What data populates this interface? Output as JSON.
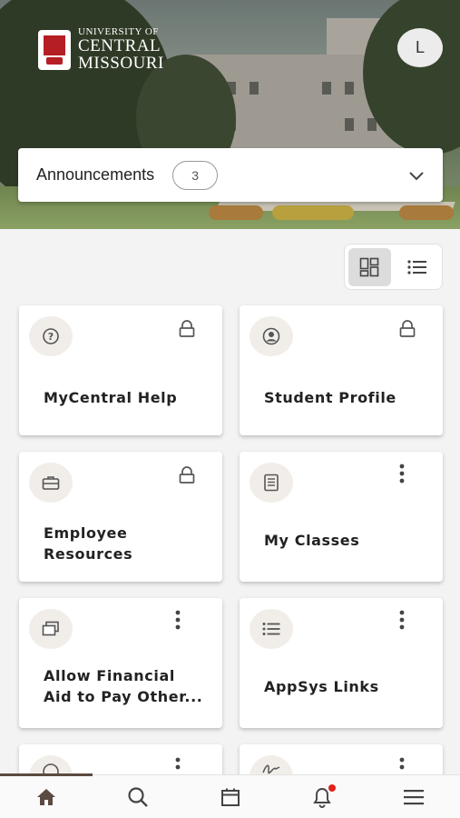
{
  "header": {
    "logo_line1": "UNIVERSITY OF",
    "logo_line2": "CENTRAL",
    "logo_line3": "MISSOURI",
    "avatar_initial": "L"
  },
  "announcements": {
    "label": "Announcements",
    "count": "3"
  },
  "tiles": [
    {
      "title": "MyCentral Help",
      "icon": "help-circle-icon",
      "corner": "lock-icon"
    },
    {
      "title": "Student Profile",
      "icon": "user-circle-icon",
      "corner": "lock-icon"
    },
    {
      "title": "Employee Resources",
      "icon": "briefcase-icon",
      "corner": "lock-icon"
    },
    {
      "title": "My Classes",
      "icon": "book-icon",
      "corner": "more-vertical-icon"
    },
    {
      "title": "Allow Financial Aid to Pay Other...",
      "icon": "windows-icon",
      "corner": "more-vertical-icon"
    },
    {
      "title": "AppSys Links",
      "icon": "list-icon",
      "corner": "more-vertical-icon"
    }
  ],
  "bottom_nav": [
    "home-icon",
    "search-icon",
    "calendar-icon",
    "bell-icon",
    "menu-icon"
  ],
  "colors": {
    "accent": "#5b4a41",
    "notification": "#e0231b",
    "brand_red": "#b51f24"
  }
}
